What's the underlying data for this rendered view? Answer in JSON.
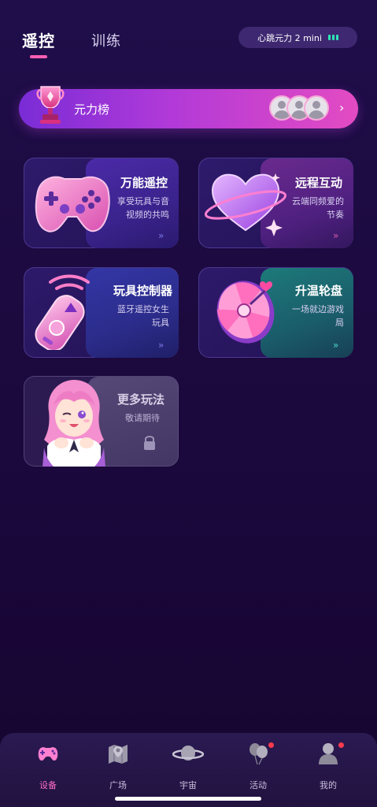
{
  "header": {
    "tabs": [
      {
        "label": "遥控",
        "active": true
      },
      {
        "label": "训练",
        "active": false
      }
    ],
    "device": {
      "name": "心跳元力 2 mini",
      "battery_icon": "battery-icon"
    }
  },
  "banner": {
    "label": "元力榜",
    "arrow": "›",
    "icon": "trophy-icon"
  },
  "cards": [
    {
      "title": "万能遥控",
      "sub1": "享受玩具与音",
      "sub2": "视频的共鸣",
      "chevron": "»",
      "icon": "gamepad-icon"
    },
    {
      "title": "远程互动",
      "sub1": "云端同频爱的",
      "sub2": "节奏",
      "chevron": "»",
      "icon": "heart-icon"
    },
    {
      "title": "玩具控制器",
      "sub1": "蓝牙遥控女生",
      "sub2": "玩具",
      "chevron": "»",
      "icon": "remote-icon"
    },
    {
      "title": "升温轮盘",
      "sub1": "一场就边游戏",
      "sub2": "局",
      "chevron": "»",
      "icon": "wheel-icon"
    },
    {
      "title": "更多玩法",
      "sub1": "敬请期待",
      "sub2": "",
      "chevron": "",
      "icon": "lock-icon"
    }
  ],
  "nav": [
    {
      "label": "设备",
      "active": true,
      "icon": "gamepad-nav-icon"
    },
    {
      "label": "广场",
      "active": false,
      "icon": "map-icon"
    },
    {
      "label": "宇宙",
      "active": false,
      "icon": "planet-icon"
    },
    {
      "label": "活动",
      "active": false,
      "icon": "balloon-icon"
    },
    {
      "label": "我的",
      "active": false,
      "icon": "profile-icon"
    }
  ],
  "colors": {
    "accent_pink": "#ff5fb4",
    "battery_green": "#2ee6b5",
    "background": "#1c0a40"
  }
}
